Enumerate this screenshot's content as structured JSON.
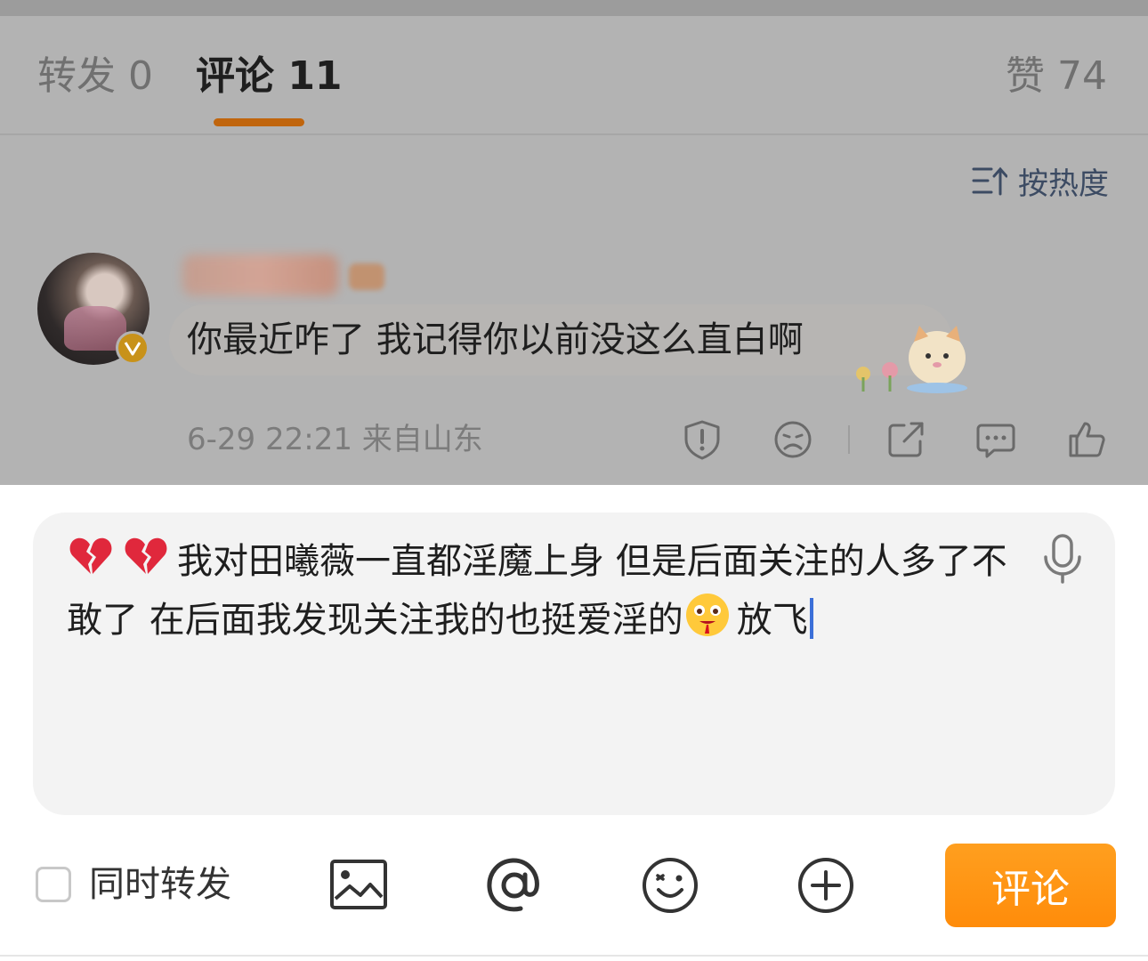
{
  "tabs": {
    "forward": "转发 0",
    "comment": "评论 11",
    "like": "赞 74"
  },
  "sort": {
    "label": "按热度",
    "icon": "sort-icon"
  },
  "comment": {
    "text": "你最近咋了 我记得你以前没这么直白啊",
    "meta": "6-29 22:21 来自山东",
    "actions": [
      "report-icon",
      "unhappy-icon",
      "share-icon",
      "reply-icon",
      "like-icon"
    ]
  },
  "compose": {
    "text_part1": "我对田曦薇一直都淫魔上身 但是后面关注的人多了不敢了 在后面我发现关注我的也挺爱淫的",
    "text_part2": "放飞",
    "leading_emojis": [
      "broken-heart-icon",
      "broken-heart-icon"
    ],
    "inline_emoji": "drooling-face-icon",
    "mic_icon": "microphone-icon"
  },
  "toolbar": {
    "sync_label": "同时转发",
    "icons": [
      "image-icon",
      "at-icon",
      "emoji-icon",
      "plus-icon"
    ],
    "submit_label": "评论"
  },
  "colors": {
    "accent": "#ff8c0a",
    "tab_indicator": "#c0650d",
    "overlay": "#b3b3b3"
  }
}
